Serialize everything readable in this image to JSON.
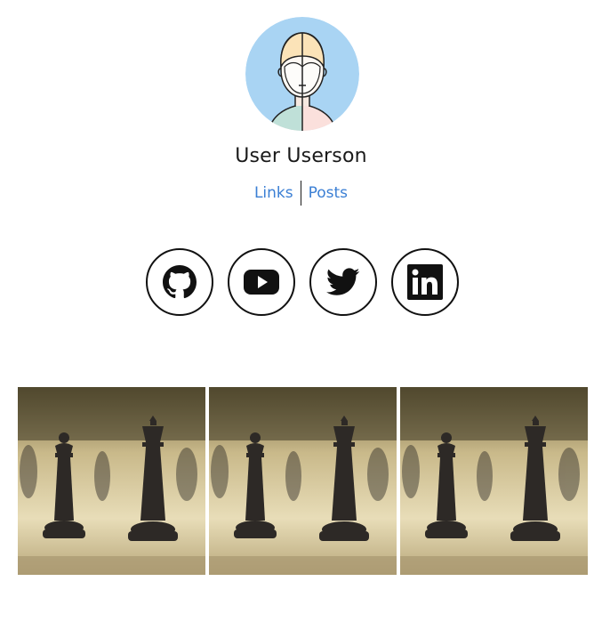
{
  "profile": {
    "name": "User Userson",
    "avatar_icon": "person-avatar-icon"
  },
  "nav": {
    "links_label": "Links",
    "posts_label": "Posts"
  },
  "socials": [
    {
      "name": "github",
      "icon": "github-icon"
    },
    {
      "name": "youtube",
      "icon": "youtube-icon"
    },
    {
      "name": "twitter",
      "icon": "twitter-icon"
    },
    {
      "name": "linkedin",
      "icon": "linkedin-icon"
    }
  ],
  "gallery": {
    "photos": [
      {
        "subject": "chess-pieces-photo"
      },
      {
        "subject": "chess-pieces-photo"
      },
      {
        "subject": "chess-pieces-photo"
      }
    ]
  },
  "colors": {
    "link": "#3b7fd4",
    "avatar_bg": "#a9d4f3"
  }
}
